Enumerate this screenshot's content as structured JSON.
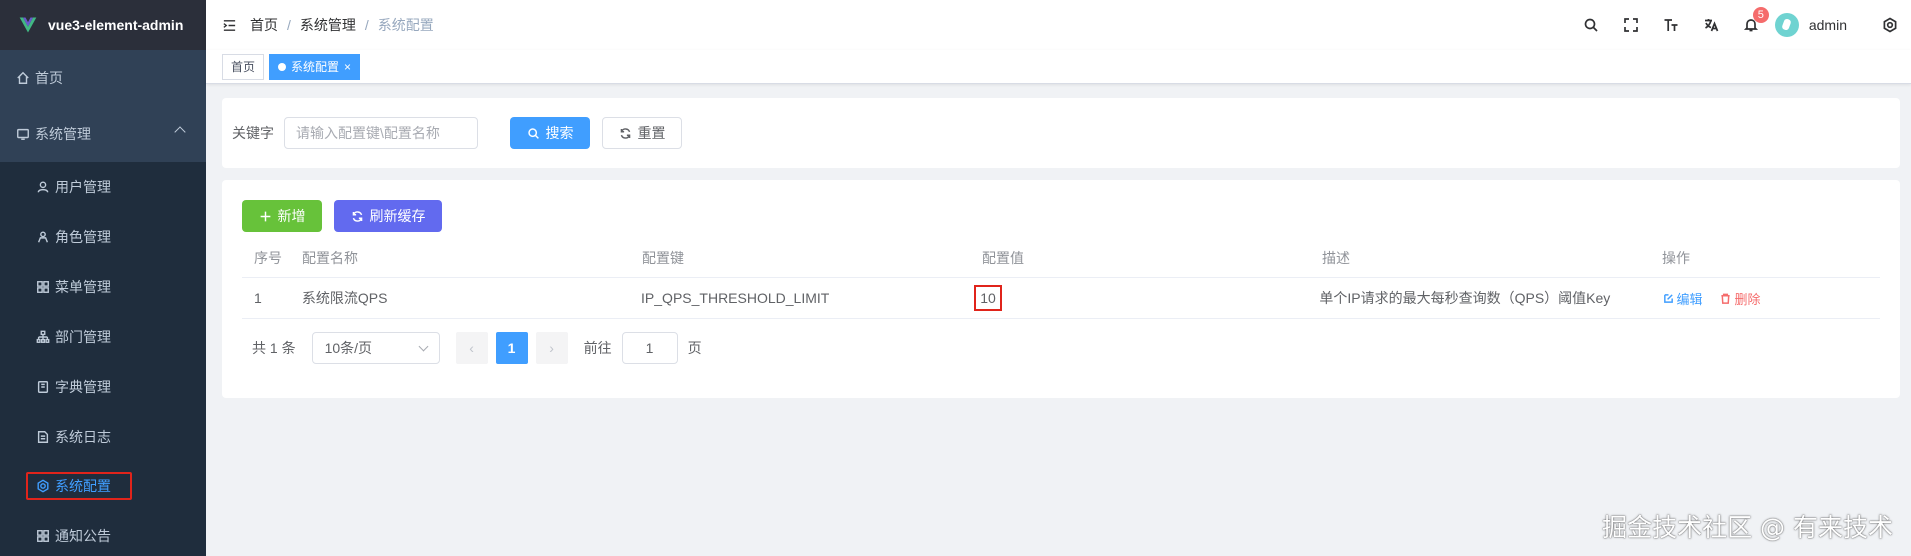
{
  "app": {
    "title": "vue3-element-admin"
  },
  "sidebar": {
    "items": [
      {
        "label": "首页",
        "icon": "home-icon"
      },
      {
        "label": "系统管理",
        "icon": "system-icon"
      },
      {
        "label": "用户管理",
        "icon": "user-icon"
      },
      {
        "label": "角色管理",
        "icon": "role-icon"
      },
      {
        "label": "菜单管理",
        "icon": "menu-icon"
      },
      {
        "label": "部门管理",
        "icon": "tree-icon"
      },
      {
        "label": "字典管理",
        "icon": "dict-icon"
      },
      {
        "label": "系统日志",
        "icon": "document-icon"
      },
      {
        "label": "系统配置",
        "icon": "setting-icon"
      },
      {
        "label": "通知公告",
        "icon": "grid-icon"
      }
    ]
  },
  "header": {
    "breadcrumb": [
      "首页",
      "系统管理",
      "系统配置"
    ],
    "notification_count": "5",
    "username": "admin"
  },
  "tags": {
    "home": "首页",
    "current": "系统配置",
    "close": "×"
  },
  "search": {
    "label": "关键字",
    "placeholder": "请输入配置键\\配置名称",
    "search_btn": "搜索",
    "reset_btn": "重置"
  },
  "toolbar": {
    "add_btn": "新增",
    "refresh_btn": "刷新缓存"
  },
  "table": {
    "headers": [
      "序号",
      "配置名称",
      "配置键",
      "配置值",
      "描述",
      "操作"
    ],
    "rows": [
      {
        "index": "1",
        "name": "系统限流QPS",
        "key": "IP_QPS_THRESHOLD_LIMIT",
        "value": "10",
        "desc": "单个IP请求的最大每秒查询数（QPS）阈值Key",
        "edit": "编辑",
        "delete": "删除"
      }
    ]
  },
  "pagination": {
    "total": "共 1 条",
    "page_size": "10条/页",
    "current_page": "1",
    "goto_label": "前往",
    "goto_value": "1",
    "page_suffix": "页",
    "prev": "‹",
    "next": "›"
  },
  "watermark": "掘金技术社区 @ 有来技术"
}
